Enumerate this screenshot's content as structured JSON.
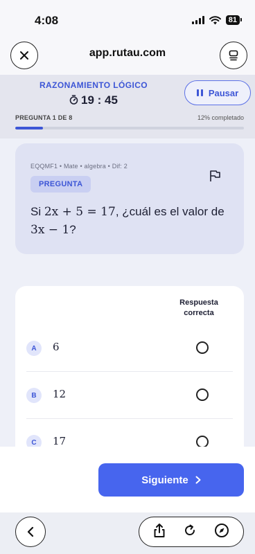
{
  "status_bar": {
    "time": "4:08",
    "battery": "81"
  },
  "browser": {
    "url": "app.rutau.com"
  },
  "exam": {
    "section": "RAZONAMIENTO LÓGICO",
    "timer": "19 : 45",
    "pause_label": "Pausar",
    "question_count": "PREGUNTA 1 DE 8",
    "progress_text": "12% completado",
    "progress_value": 0.12
  },
  "question": {
    "meta": "EQQMF1 • Mate • algebra • Dif: 2",
    "tag": "PREGUNTA",
    "text_prefix": "Si ",
    "equation": "2x + 5 = 17",
    "text_middle": ", ¿cuál es el valor de ",
    "expression": "3x − 1",
    "text_suffix": "?"
  },
  "answers": {
    "column_header": "Respuesta correcta",
    "options": [
      {
        "letter": "A",
        "value": "6"
      },
      {
        "letter": "B",
        "value": "12"
      },
      {
        "letter": "C",
        "value": "17"
      }
    ]
  },
  "footer": {
    "next_label": "Siguiente"
  },
  "icons": {
    "close": "close-icon",
    "tabs": "tabs-icon",
    "stopwatch": "stopwatch-icon",
    "flag": "flag-icon",
    "back": "back-icon",
    "share": "share-icon",
    "reload": "reload-icon",
    "compass": "compass-icon"
  },
  "colors": {
    "accent": "#3d56d6",
    "button": "#4765ee"
  }
}
